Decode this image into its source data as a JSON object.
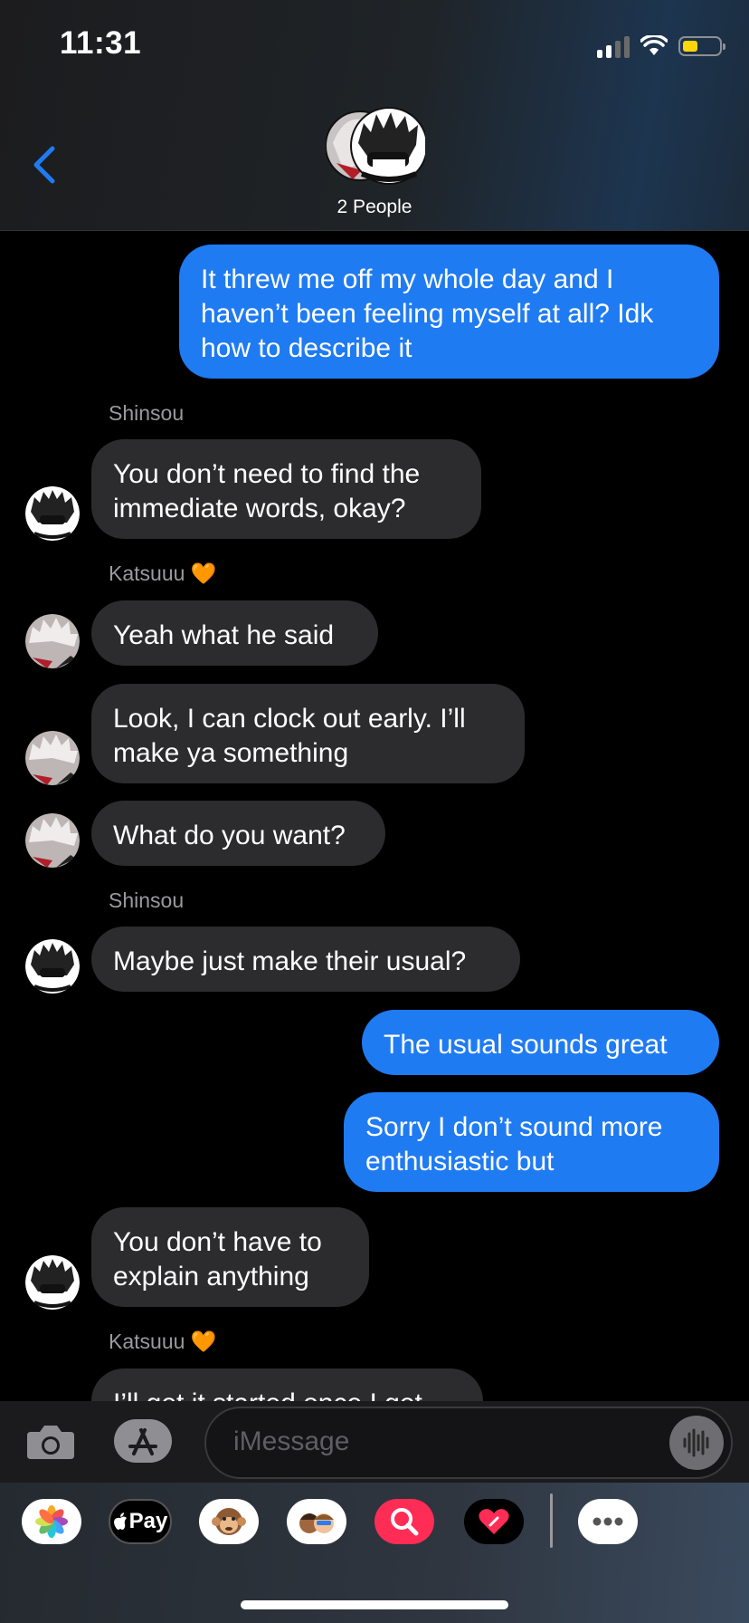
{
  "status_bar": {
    "time": "11:31"
  },
  "header": {
    "group_label": "2 People"
  },
  "messages": [
    {
      "kind": "out",
      "lines": [
        "It threw me off my whole day and I",
        "haven’t been feeling myself at all? Idk",
        "how to describe it"
      ]
    },
    {
      "kind": "sender",
      "name": "Shinsou",
      "heart": ""
    },
    {
      "kind": "in",
      "lines": [
        "You don’t need to find the",
        "immediate words, okay?"
      ]
    },
    {
      "kind": "sender",
      "name": "Katsuuu",
      "heart": "🧡"
    },
    {
      "kind": "in",
      "lines": [
        "Yeah what he said"
      ]
    },
    {
      "kind": "in",
      "lines": [
        "Look, I can clock out early. I’ll",
        "make ya something"
      ]
    },
    {
      "kind": "in",
      "lines": [
        "What do you want?"
      ]
    },
    {
      "kind": "sender",
      "name": "Shinsou",
      "heart": ""
    },
    {
      "kind": "in",
      "lines": [
        "Maybe just make their usual?"
      ]
    },
    {
      "kind": "out",
      "lines": [
        "The usual sounds great"
      ]
    },
    {
      "kind": "out",
      "lines": [
        "Sorry I don’t sound more",
        "enthusiastic but"
      ]
    },
    {
      "kind": "in",
      "lines": [
        "You don’t have to",
        "explain anything"
      ]
    },
    {
      "kind": "sender",
      "name": "Katsuuu",
      "heart": "🧡"
    },
    {
      "kind": "in",
      "lines": [
        "I’ll get it started once I get"
      ]
    }
  ],
  "composer": {
    "placeholder": "iMessage"
  },
  "app_drawer": {
    "apple_pay_label": "Pay",
    "apps": [
      "photos-icon",
      "apple-pay-icon",
      "animoji-icon",
      "memoji-icon",
      "image-search-icon",
      "digital-touch-icon",
      "more-icon"
    ]
  },
  "colors": {
    "outgoing": "#1f7bf2",
    "incoming": "#2c2c2e",
    "accent": "#1f7bf2"
  }
}
